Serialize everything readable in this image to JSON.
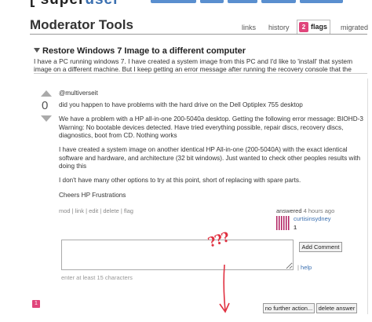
{
  "site": {
    "logo_prefix": "[",
    "logo_text": " super",
    "logo_suffix": "user"
  },
  "header": {
    "title": "Moderator Tools",
    "tabs": [
      {
        "label": "links"
      },
      {
        "label": "history"
      },
      {
        "label": "flags",
        "count": "2",
        "selected": true
      },
      {
        "label": "migrated"
      }
    ]
  },
  "question": {
    "title": "Restore Windows 7 Image to a different computer",
    "excerpt": "I have a PC running windows 7. I have created a system image from this PC and I'd like to 'install' that system image on a different machine. But I keep getting an error message after running the recovery console that the"
  },
  "answer": {
    "vote_count": "0",
    "paragraphs": [
      "@multiverseit",
      "did you happen to have problems with the hard drive on the Dell Optiplex 755 desktop",
      "We have a problem with a HP all-in-one 200-5040a desktop. Getting the following error message: BIOHD-3 Warning: No bootable devices detected. Have tried everything possible, repair discs, recovery discs, diagnostics, boot from CD. Nothing works",
      "I have created a system image on another identical HP All-in-one (200-5040A) with the exact identical software and hardware, and architecture (32 bit windows). Just wanted to check other peoples results with doing this",
      "I don't have many other options to try at this point, short of replacing with spare parts.",
      "Cheers HP Frustrations"
    ],
    "menu": {
      "mod": "mod",
      "link": "link",
      "edit": "edit",
      "delete": "delete",
      "flag": "flag",
      "sep": " | "
    },
    "answered_label": "answered",
    "answered_time": "4 hours ago",
    "user_name": "curtisinsydney",
    "user_rep": "1"
  },
  "comment": {
    "add_button": "Add Comment",
    "help": "help",
    "pipe": "|",
    "hint": "enter at least 15 characters"
  },
  "flags": {
    "badge": "1",
    "no_further_action": "no further action...",
    "delete_answer": "delete answer"
  },
  "annotation": {
    "text": "???",
    "color": "#e03040"
  },
  "colors": {
    "flag_badge": "#e0457b",
    "link": "#3a6fb0"
  }
}
